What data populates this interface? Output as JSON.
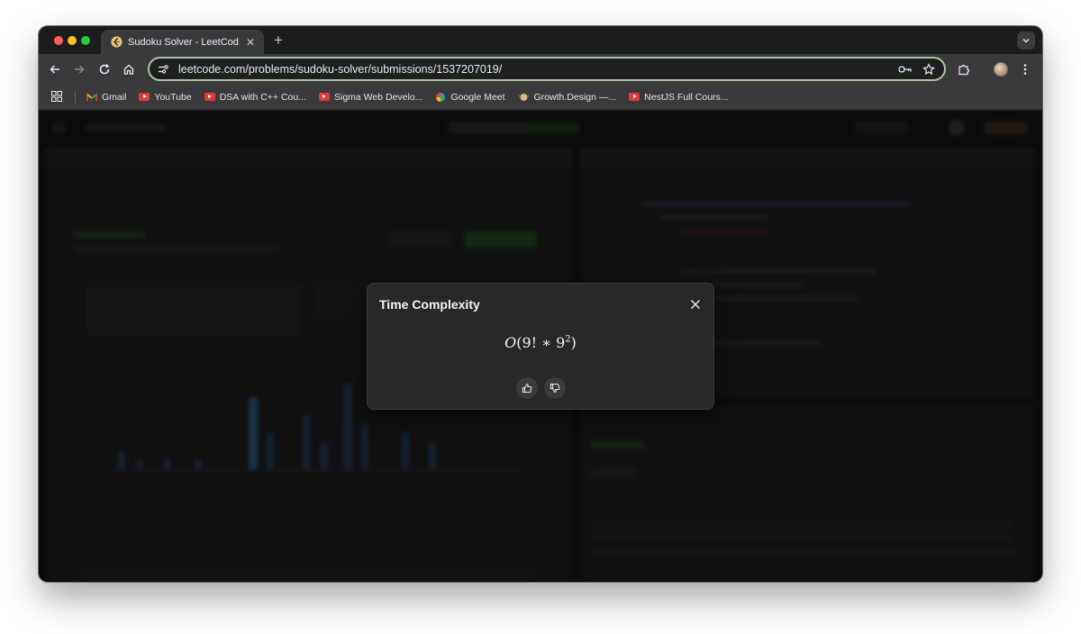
{
  "browser": {
    "tab": {
      "title": "Sudoku Solver - LeetCode",
      "close": "✕"
    },
    "new_tab": "+",
    "url": "leetcode.com/problems/sudoku-solver/submissions/1537207019/",
    "bookmarks": [
      {
        "label": "Gmail",
        "icon": "gmail-icon"
      },
      {
        "label": "YouTube",
        "icon": "youtube-icon"
      },
      {
        "label": "DSA with C++ Cou...",
        "icon": "youtube-icon"
      },
      {
        "label": "Sigma Web Develo...",
        "icon": "youtube-icon"
      },
      {
        "label": "Google Meet",
        "icon": "google-meet-icon"
      },
      {
        "label": "Growth.Design —...",
        "icon": "growth-design-icon"
      },
      {
        "label": "NestJS Full Cours...",
        "icon": "youtube-icon"
      }
    ]
  },
  "modal": {
    "title": "Time Complexity",
    "formula": {
      "func": "O",
      "open": "(9! ∗ 9",
      "exp": "2",
      "close": ")"
    }
  }
}
